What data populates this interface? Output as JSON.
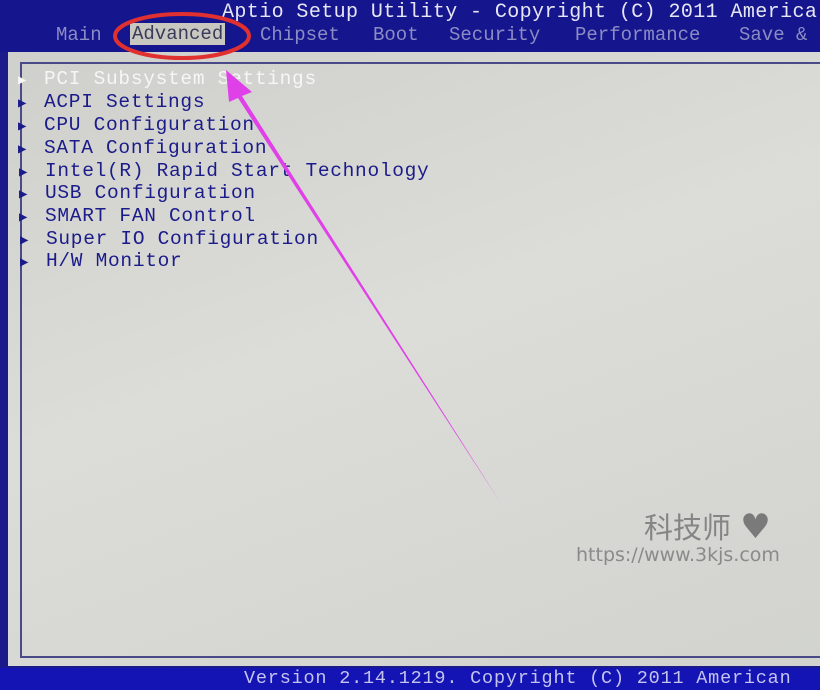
{
  "header": {
    "title": "Aptio Setup Utility - Copyright (C) 2011 America",
    "tabs": [
      {
        "label": "Main"
      },
      {
        "label": "Advanced",
        "active": true
      },
      {
        "label": "Chipset"
      },
      {
        "label": "Boot"
      },
      {
        "label": "Security"
      },
      {
        "label": "Performance"
      },
      {
        "label": "Save &"
      }
    ]
  },
  "menu": {
    "items": [
      {
        "label": "PCI Subsystem Settings",
        "selected": true
      },
      {
        "label": "ACPI Settings"
      },
      {
        "label": "CPU Configuration"
      },
      {
        "label": "SATA Configuration"
      },
      {
        "label": "Intel(R) Rapid Start Technology"
      },
      {
        "label": "USB Configuration"
      },
      {
        "label": "SMART FAN Control"
      },
      {
        "label": "Super IO Configuration"
      },
      {
        "label": "H/W Monitor"
      }
    ]
  },
  "footer": {
    "version": "Version 2.14.1219. Copyright (C) 2011 American"
  },
  "watermark": {
    "name": "科技师",
    "url": "https://www.3kjs.com"
  },
  "colors": {
    "header_bg": "#15158e",
    "panel_bg": "#d6d6d2",
    "item_text": "#1b1b8a",
    "annotation_arrow": "#e040e8",
    "annotation_circle": "#e03030"
  }
}
